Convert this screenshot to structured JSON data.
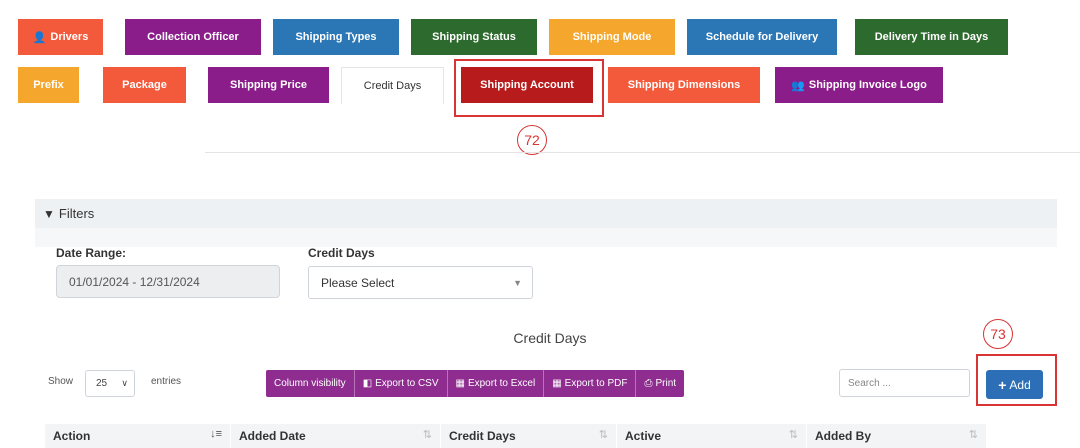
{
  "tabs": [
    {
      "label": "Drivers",
      "color": "#f35a3c",
      "icon": "user-icon"
    },
    {
      "label": "Collection Officer",
      "color": "#8a1d8a"
    },
    {
      "label": "Shipping Types",
      "color": "#2b77b6"
    },
    {
      "label": "Shipping Status",
      "color": "#2d6a2d"
    },
    {
      "label": "Shipping Mode",
      "color": "#f5a62c"
    },
    {
      "label": "Schedule for Delivery",
      "color": "#2b77b6"
    },
    {
      "label": "Delivery Time in Days",
      "color": "#2d6a2d"
    },
    {
      "label": "Prefix",
      "color": "#f5a62c"
    },
    {
      "label": "Package",
      "color": "#f35a3c"
    },
    {
      "label": "Shipping Price",
      "color": "#8a1d8a"
    },
    {
      "label": "Credit Days",
      "color": "#ffffff"
    },
    {
      "label": "Shipping Account",
      "color": "#b81b1b"
    },
    {
      "label": "Shipping Dimensions",
      "color": "#f35a3c"
    },
    {
      "label": "Shipping Invoice Logo",
      "color": "#8a1d8a",
      "icon": "users-icon"
    }
  ],
  "annotations": {
    "a72": "72",
    "a73": "73"
  },
  "filters": {
    "title": "Filters",
    "date_range_label": "Date Range:",
    "date_range_value": "01/01/2024 - 12/31/2024",
    "credit_days_label": "Credit Days",
    "credit_days_value": "Please Select"
  },
  "table": {
    "title": "Credit Days",
    "show_label": "Show",
    "page_length": "25",
    "entries_label": "entries",
    "export_buttons": [
      "Column visibility",
      "Export to CSV",
      "Export to Excel",
      "Export to PDF",
      "Print"
    ],
    "search_placeholder": "Search ...",
    "add_label": "Add",
    "columns": [
      "Action",
      "Added Date",
      "Credit Days",
      "Active",
      "Added By"
    ]
  }
}
